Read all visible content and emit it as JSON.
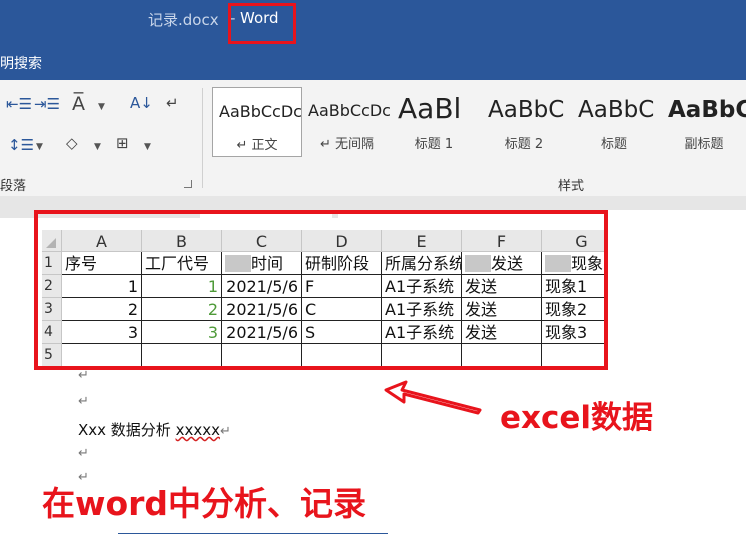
{
  "window": {
    "doc_name": "记录.docx",
    "separator": "-",
    "app_name": "Word"
  },
  "tell_me": {
    "text": "明搜索"
  },
  "ribbon": {
    "paragraph_group_label": "段落",
    "styles_group_label": "样式",
    "styles": [
      {
        "preview": "AaBbCcDc",
        "name": "↵ 正文"
      },
      {
        "preview": "AaBbCcDc",
        "name": "↵ 无间隔"
      },
      {
        "preview": "AaBl",
        "name": "标题 1"
      },
      {
        "preview": "AaBbC",
        "name": "标题 2"
      },
      {
        "preview": "AaBbC",
        "name": "标题"
      },
      {
        "preview": "AaBbC",
        "name": "副标题"
      }
    ],
    "icons": [
      "decrease-indent-icon",
      "increase-indent-icon",
      "chinese-layout-icon",
      "sort-icon",
      "show-marks-icon",
      "line-spacing-icon",
      "shading-icon",
      "borders-icon"
    ]
  },
  "sheet": {
    "columns": [
      "A",
      "B",
      "C",
      "D",
      "E",
      "F",
      "G"
    ],
    "rows": [
      "1",
      "2",
      "3",
      "4",
      "5"
    ],
    "header": [
      "序号",
      "工厂代号",
      "时间",
      "研制阶段",
      "所属分系统",
      "发送",
      "现象"
    ],
    "data": [
      [
        "1",
        "1",
        "2021/5/6",
        "F",
        "A1子系统",
        "发送",
        "现象1"
      ],
      [
        "2",
        "2",
        "2021/5/6",
        "C",
        "A1子系统",
        "发送",
        "现象2"
      ],
      [
        "3",
        "3",
        "2021/5/6",
        "S",
        "A1子系统",
        "发送",
        "现象3"
      ]
    ]
  },
  "document": {
    "para_mark": "↵",
    "line_prefix": "Xxx 数据分析 ",
    "line_squiggle": "xxxxx",
    "line_mark": "↵"
  },
  "annotations": {
    "excel_label": "excel数据",
    "word_label": "在word中分析、记录",
    "color": "#e8141c"
  },
  "colors": {
    "titlebar": "#2b579a",
    "ribbon": "#f3f3f3",
    "annotation": "#e8141c"
  }
}
